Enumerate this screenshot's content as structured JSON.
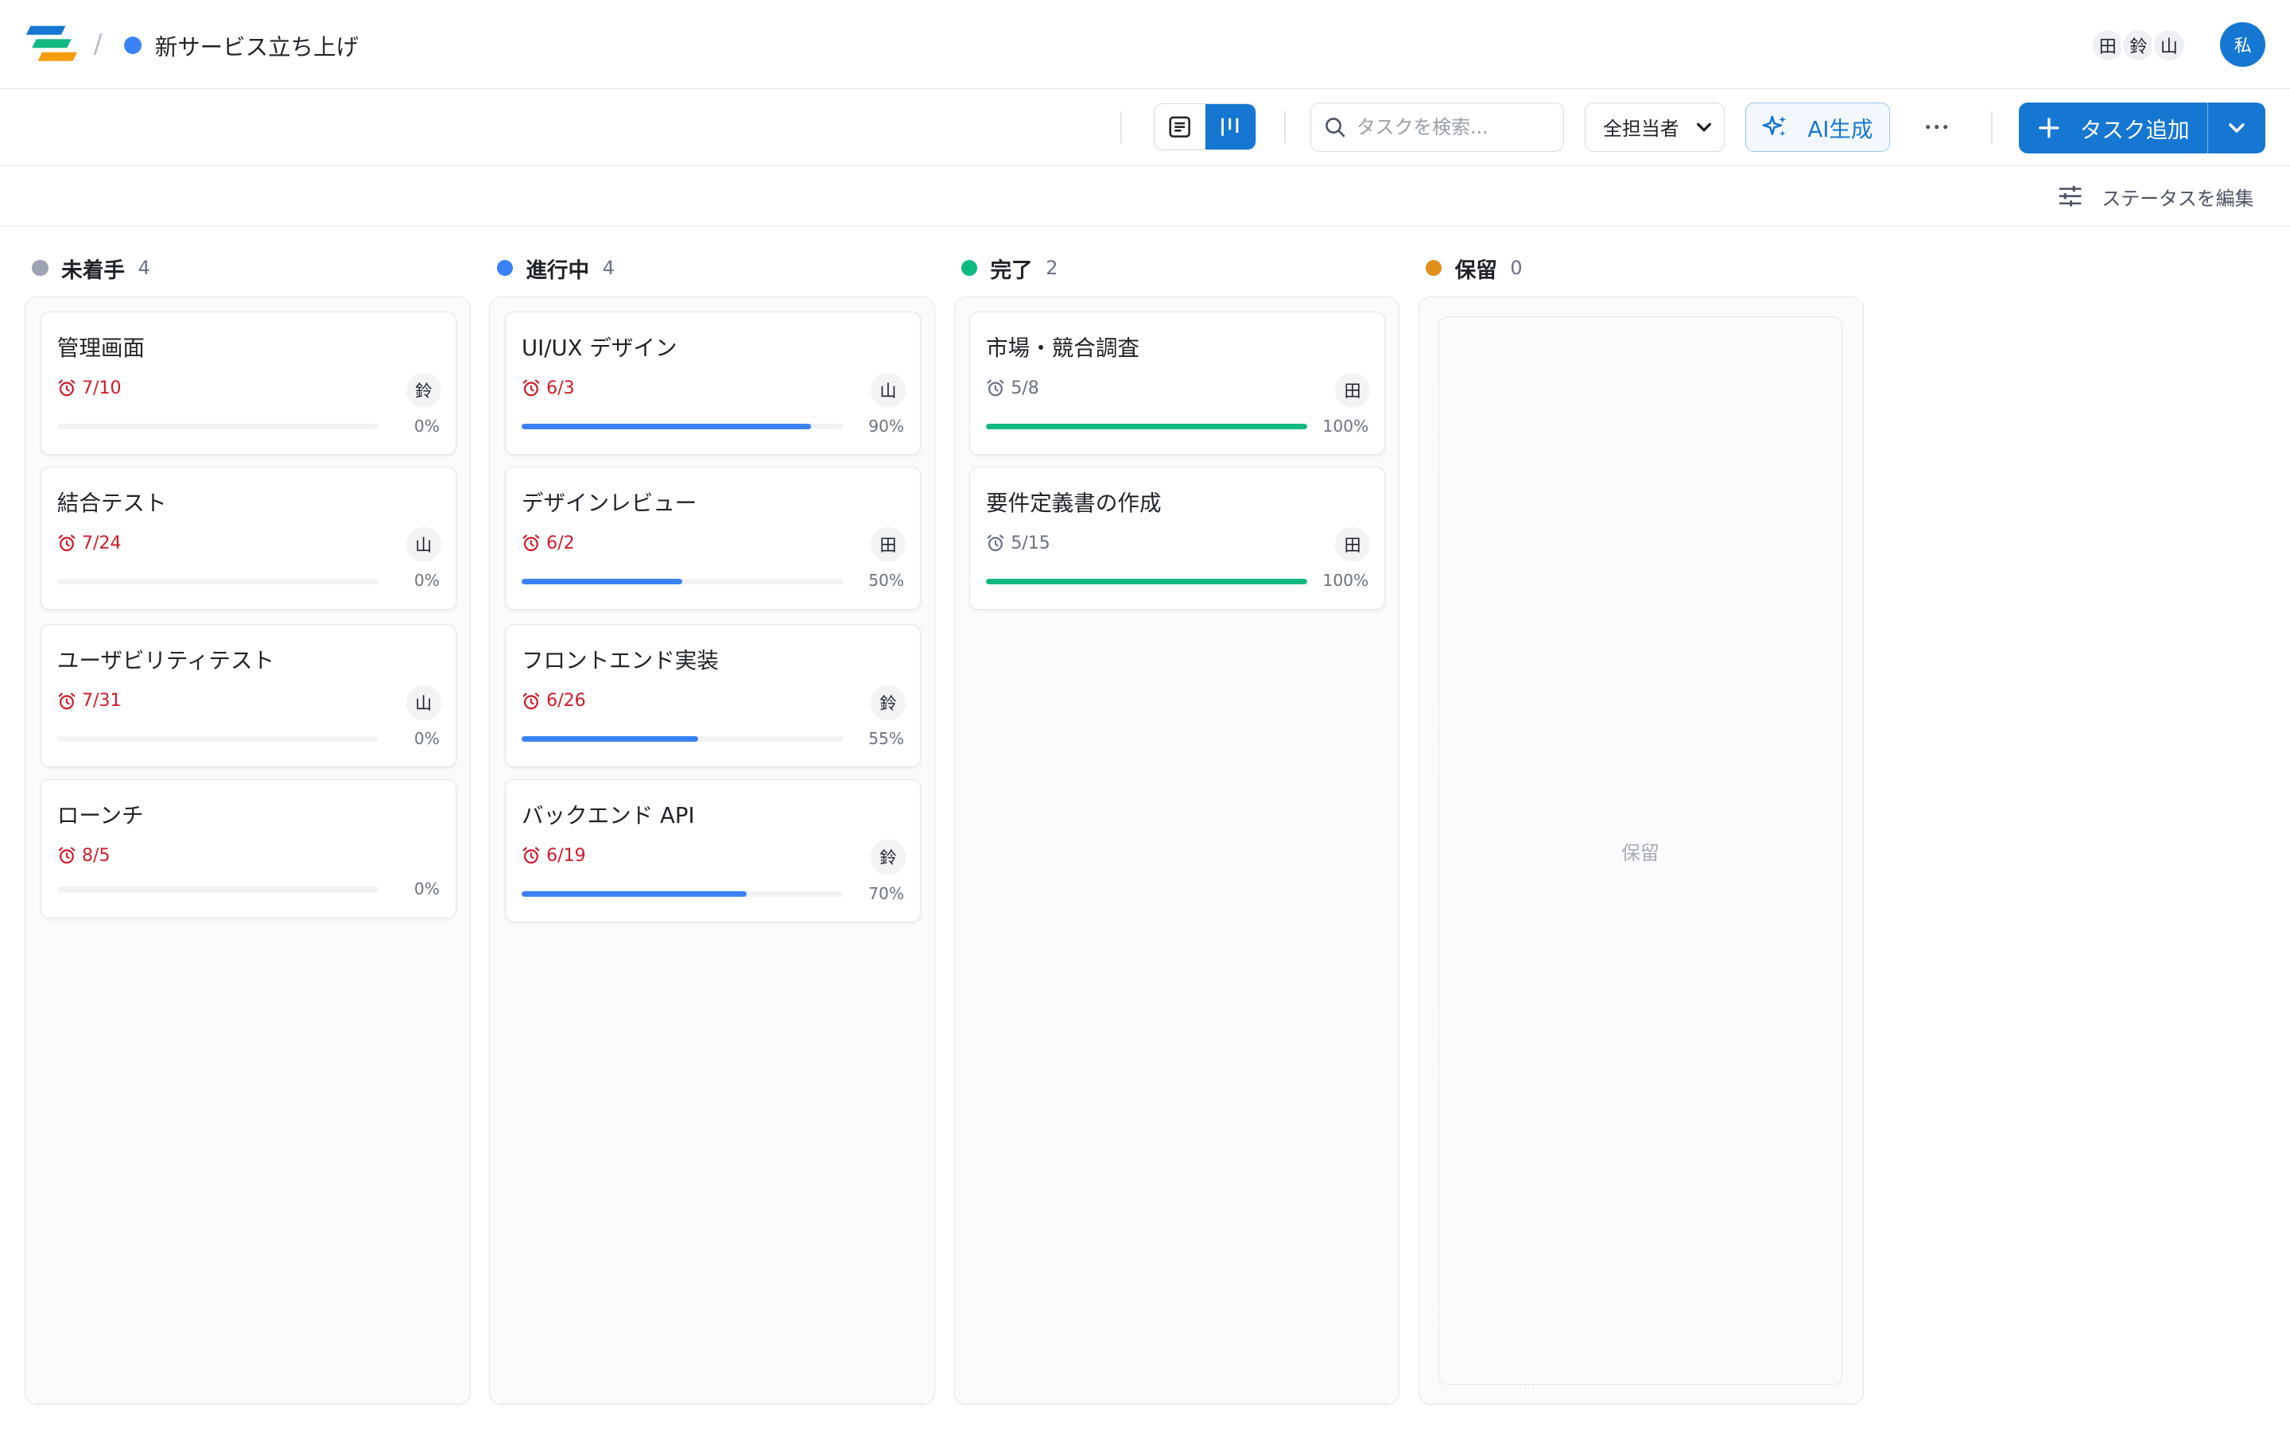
{
  "header": {
    "breadcrumb_separator": "/",
    "project_title": "新サービス立ち上げ",
    "project_color": "#3b82f6",
    "members": [
      "田",
      "鈴",
      "山"
    ],
    "current_user": "私"
  },
  "toolbar": {
    "search_placeholder": "タスクを検索...",
    "assignee_filter": "全担当者",
    "ai_label": "AI生成",
    "more_label": "⋯",
    "add_label": "タスク追加",
    "accent": "#1677d2"
  },
  "statusbar": {
    "edit_label": "ステータスを編集"
  },
  "columns": [
    {
      "name": "未着手",
      "count": "4",
      "color": "#9ca3af",
      "cards": [
        {
          "title": "管理画面",
          "due": "7/10",
          "assignee": "鈴",
          "progress": "0%"
        },
        {
          "title": "結合テスト",
          "due": "7/24",
          "assignee": "山",
          "progress": "0%"
        },
        {
          "title": "ユーザビリティテスト",
          "due": "7/31",
          "assignee": "山",
          "progress": "0%"
        },
        {
          "title": "ローンチ",
          "due": "8/5",
          "assignee": "",
          "progress": "0%"
        }
      ]
    },
    {
      "name": "進行中",
      "count": "4",
      "color": "#3b82f6",
      "cards": [
        {
          "title": "UI/UX デザイン",
          "due": "6/3",
          "assignee": "山",
          "progress": "90%"
        },
        {
          "title": "デザインレビュー",
          "due": "6/2",
          "assignee": "田",
          "progress": "50%"
        },
        {
          "title": "フロントエンド実装",
          "due": "6/26",
          "assignee": "鈴",
          "progress": "55%"
        },
        {
          "title": "バックエンド API",
          "due": "6/19",
          "assignee": "鈴",
          "progress": "70%"
        }
      ]
    },
    {
      "name": "完了",
      "count": "2",
      "color": "#10b981",
      "cards": [
        {
          "title": "市場・競合調査",
          "due": "5/8",
          "assignee": "田",
          "progress": "100%"
        },
        {
          "title": "要件定義書の作成",
          "due": "5/15",
          "assignee": "田",
          "progress": "100%"
        }
      ]
    },
    {
      "name": "保留",
      "count": "0",
      "color": "#e0901a",
      "empty_label": "保留",
      "cards": []
    }
  ],
  "colors": {
    "overdue": "#d11a2a",
    "in_progress_bar": "#3b82f6",
    "done_bar": "#10b981"
  }
}
